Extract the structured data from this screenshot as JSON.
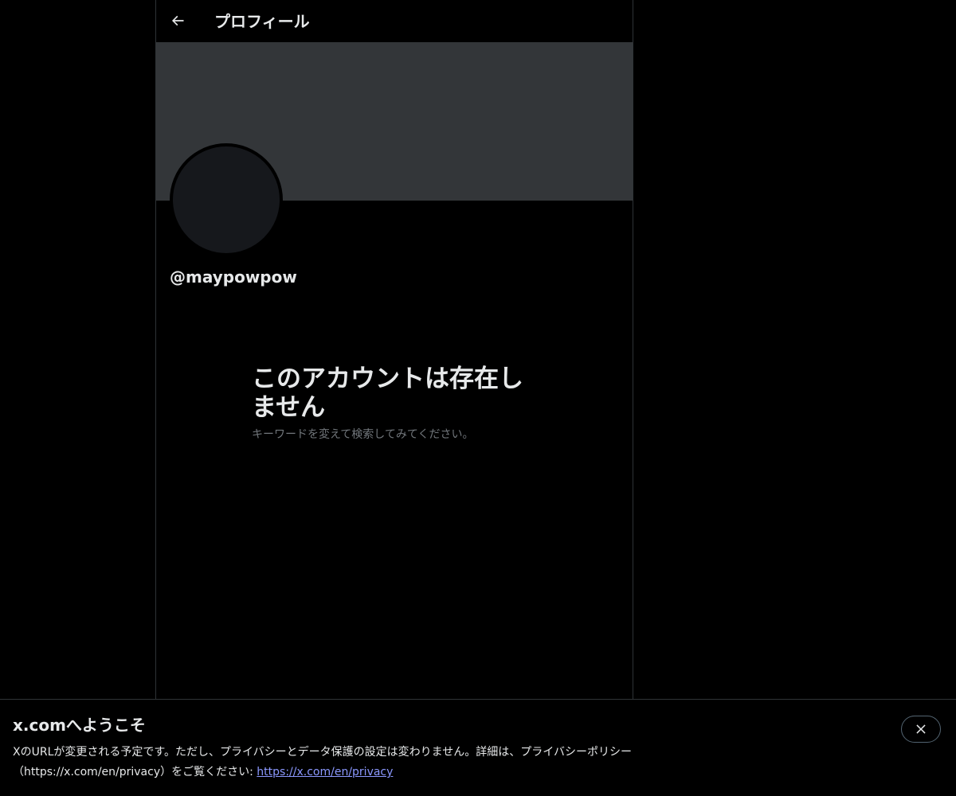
{
  "header": {
    "title": "プロフィール",
    "back_icon": "arrow-left-icon"
  },
  "profile": {
    "handle": "@maypowpow"
  },
  "empty_state": {
    "title": "このアカウントは存在しません",
    "subtitle": "キーワードを変えて検索してみてください。"
  },
  "notice": {
    "title": "x.comへようこそ",
    "message": "XのURLが変更される予定です。ただし、プライバシーとデータ保護の設定は変わりません。詳細は、プライバシーポリシー（https://x.com/en/privacy）をご覧ください: ",
    "link_text": "https://x.com/en/privacy",
    "close_icon": "close-icon"
  },
  "colors": {
    "background": "#000000",
    "banner": "#333639",
    "avatar": "#16181c",
    "text_primary": "#e7e9ea",
    "text_secondary": "#71767b",
    "link": "#8b98ff",
    "border": "#2f3336"
  }
}
